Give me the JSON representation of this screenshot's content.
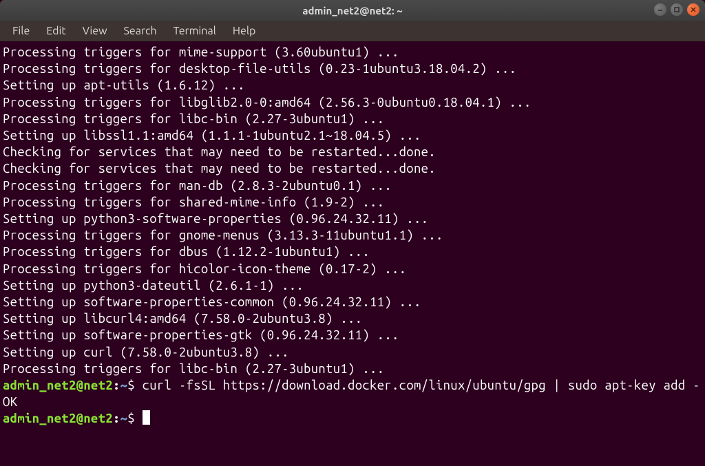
{
  "window": {
    "title": "admin_net2@net2: ~"
  },
  "menu": {
    "file": "File",
    "edit": "Edit",
    "view": "View",
    "search": "Search",
    "terminal": "Terminal",
    "help": "Help"
  },
  "output": {
    "l0": "Processing triggers for mime-support (3.60ubuntu1) ...",
    "l1": "Processing triggers for desktop-file-utils (0.23-1ubuntu3.18.04.2) ...",
    "l2": "Setting up apt-utils (1.6.12) ...",
    "l3": "Processing triggers for libglib2.0-0:amd64 (2.56.3-0ubuntu0.18.04.1) ...",
    "l4": "Processing triggers for libc-bin (2.27-3ubuntu1) ...",
    "l5": "Setting up libssl1.1:amd64 (1.1.1-1ubuntu2.1~18.04.5) ...",
    "l6": "Checking for services that may need to be restarted...done.",
    "l7": "Checking for services that may need to be restarted...done.",
    "l8": "Processing triggers for man-db (2.8.3-2ubuntu0.1) ...",
    "l9": "Processing triggers for shared-mime-info (1.9-2) ...",
    "l10": "Setting up python3-software-properties (0.96.24.32.11) ...",
    "l11": "Processing triggers for gnome-menus (3.13.3-11ubuntu1.1) ...",
    "l12": "Processing triggers for dbus (1.12.2-1ubuntu1) ...",
    "l13": "Processing triggers for hicolor-icon-theme (0.17-2) ...",
    "l14": "Setting up python3-dateutil (2.6.1-1) ...",
    "l15": "Setting up software-properties-common (0.96.24.32.11) ...",
    "l16": "Setting up libcurl4:amd64 (7.58.0-2ubuntu3.8) ...",
    "l17": "Setting up software-properties-gtk (0.96.24.32.11) ...",
    "l18": "Setting up curl (7.58.0-2ubuntu3.8) ...",
    "l19": "Processing triggers for libc-bin (2.27-3ubuntu1) ..."
  },
  "prompt": {
    "user_host": "admin_net2@net2",
    "colon": ":",
    "path": "~",
    "dollar": "$ "
  },
  "cmd1": "curl -fsSL https://download.docker.com/linux/ubuntu/gpg | sudo apt-key add -",
  "ok": "OK",
  "cmd2": ""
}
